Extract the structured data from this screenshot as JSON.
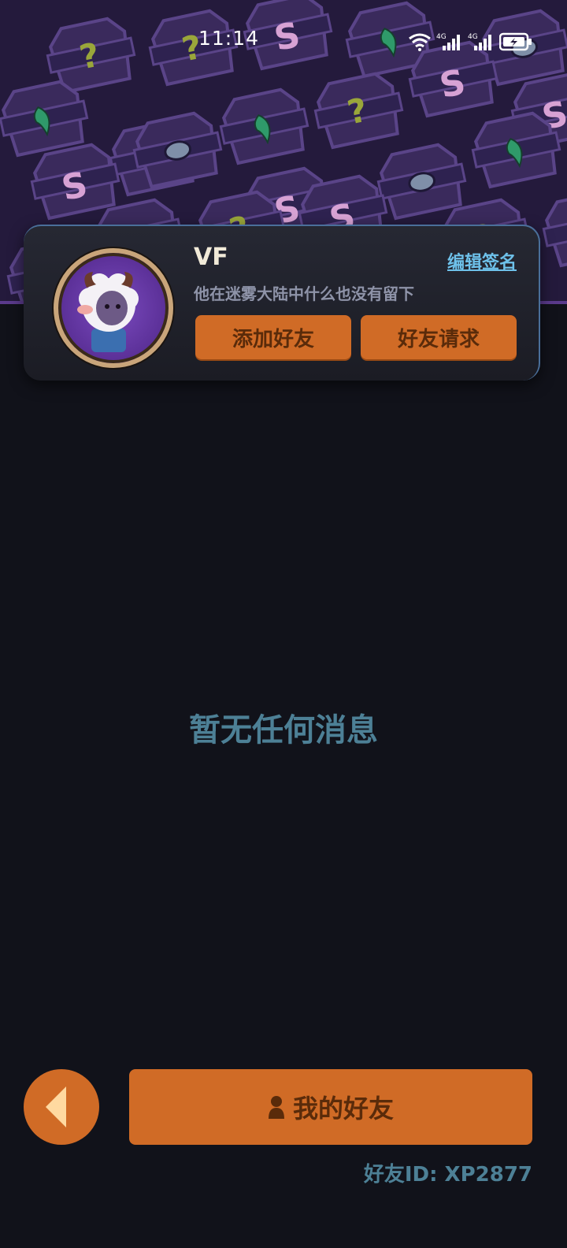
{
  "status_bar": {
    "time": "11:14",
    "icons": [
      "wifi-icon",
      "signal-4g-icon",
      "signal-4g-icon",
      "battery-charging-icon"
    ]
  },
  "banner": {
    "pattern_icons": [
      "s-badge-icon",
      "question-badge-icon",
      "gem-badge-icon",
      "leaf-badge-icon"
    ]
  },
  "profile": {
    "name": "VF",
    "signature": "他在迷雾大陆中什么也没有留下",
    "edit_signature_label": "编辑签名",
    "add_friend_label": "添加好友",
    "friend_requests_label": "好友请求",
    "avatar_icon": "sheep-avatar-icon"
  },
  "messages": {
    "empty_text": "暂无任何消息"
  },
  "bottom": {
    "back_icon": "back-arrow-icon",
    "my_friends_label": "我的好友",
    "my_friends_icon": "person-icon",
    "friend_id_text": "好友ID: XP2877"
  },
  "colors": {
    "background": "#11121a",
    "banner": "#241a3c",
    "accent_orange": "#d06b26",
    "accent_text": "#5a2b0a",
    "muted_teal": "#4d8096",
    "link_blue": "#6ec1ea"
  }
}
